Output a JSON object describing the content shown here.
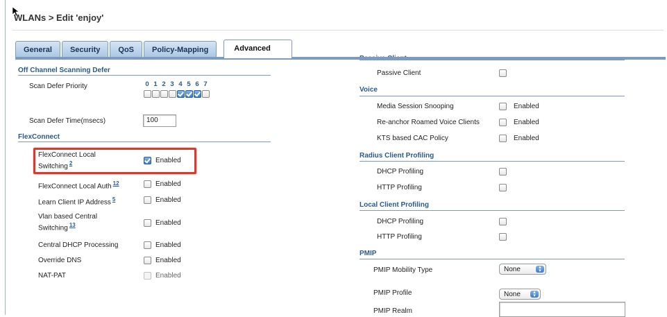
{
  "header": {
    "title": "WLANs > Edit  'enjoy'"
  },
  "tabs": [
    {
      "label": "General",
      "active": false
    },
    {
      "label": "Security",
      "active": false
    },
    {
      "label": "QoS",
      "active": false
    },
    {
      "label": "Policy-Mapping",
      "active": false
    },
    {
      "label": "Advanced",
      "active": true
    }
  ],
  "left": {
    "off_channel": {
      "heading": "Off Channel Scanning Defer",
      "priority_label": "Scan Defer Priority",
      "priority_digits": [
        "0",
        "1",
        "2",
        "3",
        "4",
        "5",
        "6",
        "7"
      ],
      "priority_checked": [
        false,
        false,
        false,
        false,
        true,
        true,
        true,
        false
      ],
      "time_label": "Scan Defer Time(msecs)",
      "time_value": "100"
    },
    "flexconnect": {
      "heading": "FlexConnect",
      "rows": [
        {
          "label": "FlexConnect Local Switching",
          "ref": "2",
          "checked": true,
          "disabled": false,
          "text": "Enabled"
        },
        {
          "label": "FlexConnect Local Auth",
          "ref": "12",
          "checked": false,
          "disabled": false,
          "text": "Enabled"
        },
        {
          "label": "Learn Client IP Address",
          "ref": "5",
          "checked": false,
          "disabled": false,
          "text": "Enabled"
        },
        {
          "label": "Vlan based Central Switching",
          "ref": "13",
          "checked": false,
          "disabled": false,
          "text": "Enabled"
        },
        {
          "label": "Central DHCP Processing",
          "ref": "",
          "checked": false,
          "disabled": false,
          "text": "Enabled"
        },
        {
          "label": "Override DNS",
          "ref": "",
          "checked": false,
          "disabled": false,
          "text": "Enabled"
        },
        {
          "label": "NAT-PAT",
          "ref": "",
          "checked": false,
          "disabled": true,
          "text": "Enabled"
        }
      ]
    }
  },
  "right": {
    "passive_heading": "Passive Client",
    "passive_label": "Passive Client",
    "voice": {
      "heading": "Voice",
      "rows": [
        {
          "label": "Media Session Snooping",
          "text": "Enabled"
        },
        {
          "label": "Re-anchor Roamed Voice Clients",
          "text": "Enabled"
        },
        {
          "label": "KTS based CAC Policy",
          "text": "Enabled"
        }
      ]
    },
    "radius": {
      "heading": "Radius Client Profiling",
      "rows": [
        {
          "label": "DHCP Profiling"
        },
        {
          "label": "HTTP Profiling"
        }
      ]
    },
    "local": {
      "heading": "Local Client Profiling",
      "rows": [
        {
          "label": "DHCP Profiling"
        },
        {
          "label": "HTTP Profiling"
        }
      ]
    },
    "pmip": {
      "heading": "PMIP",
      "mobility_label": "PMIP Mobility Type",
      "mobility_value": "None",
      "profile_label": "PMIP Profile",
      "profile_value": "None",
      "realm_label": "PMIP Realm",
      "realm_value": ""
    }
  }
}
